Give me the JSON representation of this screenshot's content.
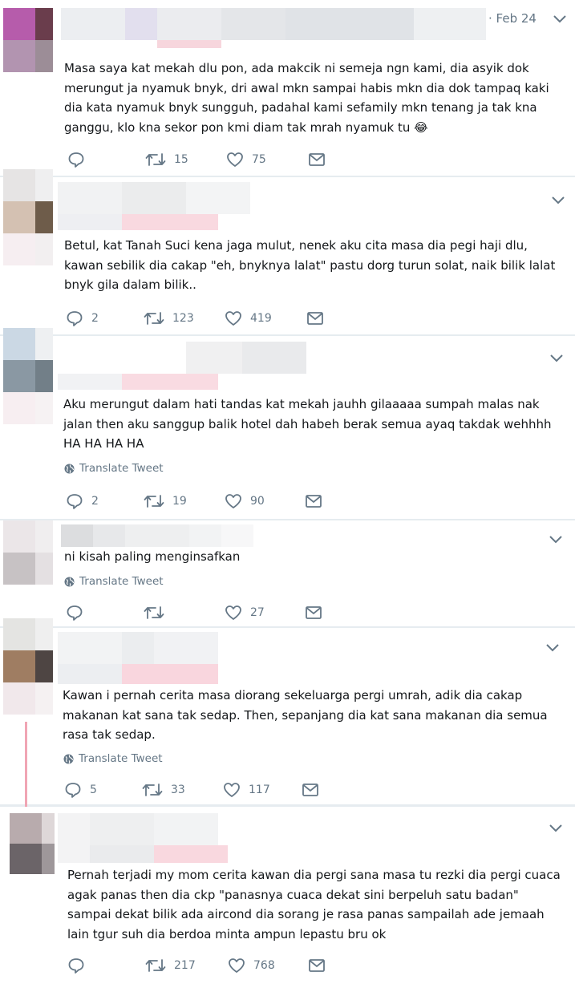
{
  "tweets": [
    {
      "date": "· Feb 24",
      "text": "Masa saya kat mekah dlu pon, ada makcik ni semeja ngn kami, dia asyik dok\nmerungut ja nyamuk bnyk, dri awal mkn sampai habis mkn dia dok tampaq kaki\ndia kata nyamuk bnyk sungguh, padahal kami sefamily mkn tenang ja tak kna\nganggu, klo kna sekor pon kmi diam tak mrah nyamuk tu 😂",
      "replies": "",
      "retweets": "15",
      "likes": "75"
    },
    {
      "text": "Betul, kat Tanah Suci kena jaga mulut, nenek aku cita masa dia pegi haji dlu,\nkawan sebilik dia cakap \"eh, bnyknya lalat\" pastu dorg turun solat, naik bilik lalat\nbnyk gila dalam bilik..",
      "replies": "2",
      "retweets": "123",
      "likes": "419"
    },
    {
      "text": "Aku merungut dalam hati tandas kat mekah jauhh gilaaaaa sumpah malas nak\njalan then aku sanggup balik hotel dah habeh berak semua ayaq takdak wehhhh\nHA HA HA HA",
      "translate": "Translate Tweet",
      "replies": "2",
      "retweets": "19",
      "likes": "90"
    },
    {
      "text": "ni kisah paling menginsafkan",
      "translate": "Translate Tweet",
      "replies": "",
      "retweets": "",
      "likes": "27"
    },
    {
      "text": "Kawan i pernah cerita masa diorang sekeluarga pergi umrah, adik dia cakap\nmakanan kat sana tak sedap. Then, sepanjang dia kat sana makanan dia semua\nrasa tak sedap.",
      "translate": "Translate Tweet",
      "replies": "5",
      "retweets": "33",
      "likes": "117"
    },
    {
      "text": "Pernah terjadi my mom cerita kawan dia pergi sana masa tu rezki dia pergi cuaca\nagak panas then dia ckp \"panasnya cuaca dekat sini berpeluh satu badan\"\nsampai dekat bilik ada aircond dia sorang je rasa panas sampailah ade jemaah\nlain tgur suh dia berdoa minta ampun lepastu bru ok",
      "replies": "",
      "retweets": "217",
      "likes": "768"
    }
  ],
  "colors": {
    "text": "#14171a",
    "muted": "#657786",
    "thread": "#f0a5b4",
    "divider": "#e6ecf0"
  }
}
